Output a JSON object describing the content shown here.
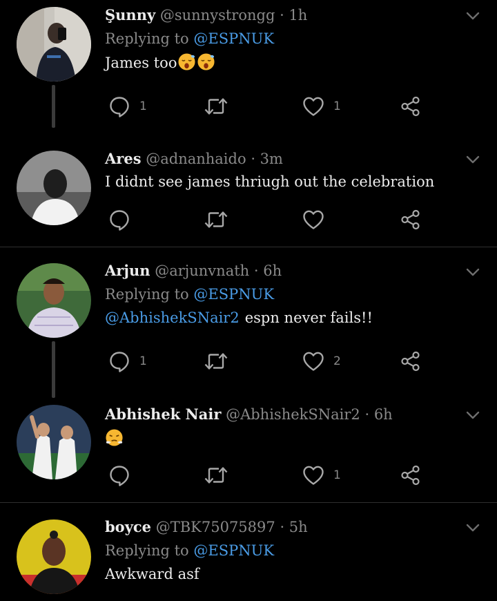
{
  "tweets": [
    {
      "name": "Şunny",
      "handle": "@sunnystrongg",
      "time": "· 1h",
      "reply_prefix": "Replying to",
      "reply_to": "@ESPNUK",
      "text": "James too",
      "emoji": [
        "sleepy-face-emoji",
        "sleepy-face-emoji"
      ],
      "reply_count": "1",
      "like_count": "1"
    },
    {
      "name": "Ares",
      "handle": "@adnanhaido",
      "time": "· 3m",
      "text": "I didnt see james thriugh out the celebration",
      "reply_count": "",
      "like_count": ""
    },
    {
      "name": "Arjun",
      "handle": "@arjunvnath",
      "time": "· 6h",
      "reply_prefix": "Replying to",
      "reply_to": "@ESPNUK",
      "mention": "@AbhishekSNair2",
      "text": "espn never fails!!",
      "reply_count": "1",
      "like_count": "2"
    },
    {
      "name": "Abhishek Nair",
      "handle": "@AbhishekSNair2",
      "time": "· 6h",
      "text": "",
      "emoji": [
        "face-with-steam-emoji"
      ],
      "reply_count": "",
      "like_count": "1"
    },
    {
      "name": "boyce",
      "handle": "@TBK75075897",
      "time": "· 5h",
      "reply_prefix": "Replying to",
      "reply_to": "@ESPNUK",
      "text": "Awkward asf"
    }
  ],
  "colors": {
    "background": "#000000",
    "mention": "#4a9ce6",
    "muted": "#8a8a8a",
    "text": "#ececec"
  }
}
